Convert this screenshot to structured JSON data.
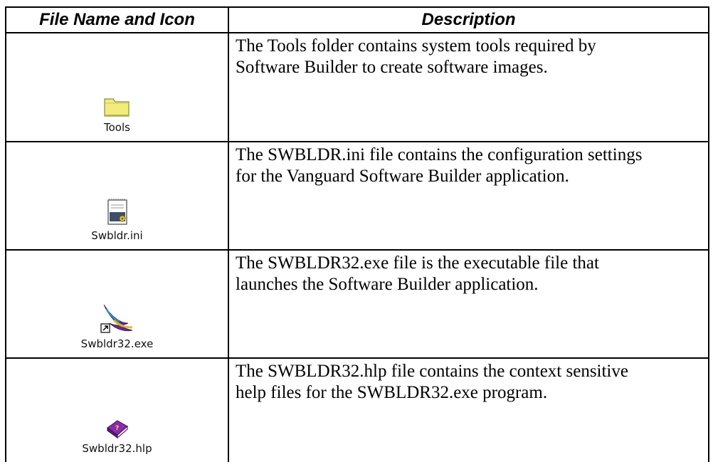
{
  "table": {
    "headers": {
      "col1": "File Name and Icon",
      "col2": "Description"
    },
    "rows": [
      {
        "file_name": "Tools",
        "icon": "folder-icon",
        "description": "The Tools folder contains system tools required by\nSoftware Builder to create software images."
      },
      {
        "file_name": "Swbldr.ini",
        "icon": "config-file-icon",
        "description": "The SWBLDR.ini file contains the configuration settings\nfor the Vanguard Software Builder application."
      },
      {
        "file_name": "Swbldr32.exe",
        "icon": "application-shortcut-icon",
        "description": "The SWBLDR32.exe file is the executable file that\nlaunches the Software Builder application."
      },
      {
        "file_name": "Swbldr32.hlp",
        "icon": "help-book-icon",
        "description": "The SWBLDR32.hlp file contains the context sensitive\nhelp files for the SWBLDR32.exe program."
      }
    ]
  }
}
